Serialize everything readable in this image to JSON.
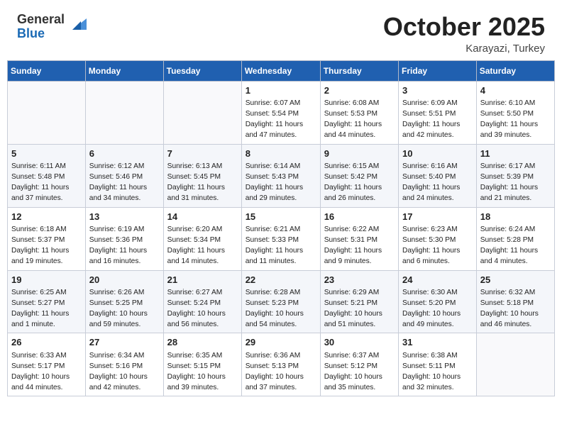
{
  "header": {
    "logo_general": "General",
    "logo_blue": "Blue",
    "month": "October 2025",
    "location": "Karayazi, Turkey"
  },
  "days_of_week": [
    "Sunday",
    "Monday",
    "Tuesday",
    "Wednesday",
    "Thursday",
    "Friday",
    "Saturday"
  ],
  "weeks": [
    [
      {
        "day": "",
        "sunrise": "",
        "sunset": "",
        "daylight": ""
      },
      {
        "day": "",
        "sunrise": "",
        "sunset": "",
        "daylight": ""
      },
      {
        "day": "",
        "sunrise": "",
        "sunset": "",
        "daylight": ""
      },
      {
        "day": "1",
        "sunrise": "Sunrise: 6:07 AM",
        "sunset": "Sunset: 5:54 PM",
        "daylight": "Daylight: 11 hours and 47 minutes."
      },
      {
        "day": "2",
        "sunrise": "Sunrise: 6:08 AM",
        "sunset": "Sunset: 5:53 PM",
        "daylight": "Daylight: 11 hours and 44 minutes."
      },
      {
        "day": "3",
        "sunrise": "Sunrise: 6:09 AM",
        "sunset": "Sunset: 5:51 PM",
        "daylight": "Daylight: 11 hours and 42 minutes."
      },
      {
        "day": "4",
        "sunrise": "Sunrise: 6:10 AM",
        "sunset": "Sunset: 5:50 PM",
        "daylight": "Daylight: 11 hours and 39 minutes."
      }
    ],
    [
      {
        "day": "5",
        "sunrise": "Sunrise: 6:11 AM",
        "sunset": "Sunset: 5:48 PM",
        "daylight": "Daylight: 11 hours and 37 minutes."
      },
      {
        "day": "6",
        "sunrise": "Sunrise: 6:12 AM",
        "sunset": "Sunset: 5:46 PM",
        "daylight": "Daylight: 11 hours and 34 minutes."
      },
      {
        "day": "7",
        "sunrise": "Sunrise: 6:13 AM",
        "sunset": "Sunset: 5:45 PM",
        "daylight": "Daylight: 11 hours and 31 minutes."
      },
      {
        "day": "8",
        "sunrise": "Sunrise: 6:14 AM",
        "sunset": "Sunset: 5:43 PM",
        "daylight": "Daylight: 11 hours and 29 minutes."
      },
      {
        "day": "9",
        "sunrise": "Sunrise: 6:15 AM",
        "sunset": "Sunset: 5:42 PM",
        "daylight": "Daylight: 11 hours and 26 minutes."
      },
      {
        "day": "10",
        "sunrise": "Sunrise: 6:16 AM",
        "sunset": "Sunset: 5:40 PM",
        "daylight": "Daylight: 11 hours and 24 minutes."
      },
      {
        "day": "11",
        "sunrise": "Sunrise: 6:17 AM",
        "sunset": "Sunset: 5:39 PM",
        "daylight": "Daylight: 11 hours and 21 minutes."
      }
    ],
    [
      {
        "day": "12",
        "sunrise": "Sunrise: 6:18 AM",
        "sunset": "Sunset: 5:37 PM",
        "daylight": "Daylight: 11 hours and 19 minutes."
      },
      {
        "day": "13",
        "sunrise": "Sunrise: 6:19 AM",
        "sunset": "Sunset: 5:36 PM",
        "daylight": "Daylight: 11 hours and 16 minutes."
      },
      {
        "day": "14",
        "sunrise": "Sunrise: 6:20 AM",
        "sunset": "Sunset: 5:34 PM",
        "daylight": "Daylight: 11 hours and 14 minutes."
      },
      {
        "day": "15",
        "sunrise": "Sunrise: 6:21 AM",
        "sunset": "Sunset: 5:33 PM",
        "daylight": "Daylight: 11 hours and 11 minutes."
      },
      {
        "day": "16",
        "sunrise": "Sunrise: 6:22 AM",
        "sunset": "Sunset: 5:31 PM",
        "daylight": "Daylight: 11 hours and 9 minutes."
      },
      {
        "day": "17",
        "sunrise": "Sunrise: 6:23 AM",
        "sunset": "Sunset: 5:30 PM",
        "daylight": "Daylight: 11 hours and 6 minutes."
      },
      {
        "day": "18",
        "sunrise": "Sunrise: 6:24 AM",
        "sunset": "Sunset: 5:28 PM",
        "daylight": "Daylight: 11 hours and 4 minutes."
      }
    ],
    [
      {
        "day": "19",
        "sunrise": "Sunrise: 6:25 AM",
        "sunset": "Sunset: 5:27 PM",
        "daylight": "Daylight: 11 hours and 1 minute."
      },
      {
        "day": "20",
        "sunrise": "Sunrise: 6:26 AM",
        "sunset": "Sunset: 5:25 PM",
        "daylight": "Daylight: 10 hours and 59 minutes."
      },
      {
        "day": "21",
        "sunrise": "Sunrise: 6:27 AM",
        "sunset": "Sunset: 5:24 PM",
        "daylight": "Daylight: 10 hours and 56 minutes."
      },
      {
        "day": "22",
        "sunrise": "Sunrise: 6:28 AM",
        "sunset": "Sunset: 5:23 PM",
        "daylight": "Daylight: 10 hours and 54 minutes."
      },
      {
        "day": "23",
        "sunrise": "Sunrise: 6:29 AM",
        "sunset": "Sunset: 5:21 PM",
        "daylight": "Daylight: 10 hours and 51 minutes."
      },
      {
        "day": "24",
        "sunrise": "Sunrise: 6:30 AM",
        "sunset": "Sunset: 5:20 PM",
        "daylight": "Daylight: 10 hours and 49 minutes."
      },
      {
        "day": "25",
        "sunrise": "Sunrise: 6:32 AM",
        "sunset": "Sunset: 5:18 PM",
        "daylight": "Daylight: 10 hours and 46 minutes."
      }
    ],
    [
      {
        "day": "26",
        "sunrise": "Sunrise: 6:33 AM",
        "sunset": "Sunset: 5:17 PM",
        "daylight": "Daylight: 10 hours and 44 minutes."
      },
      {
        "day": "27",
        "sunrise": "Sunrise: 6:34 AM",
        "sunset": "Sunset: 5:16 PM",
        "daylight": "Daylight: 10 hours and 42 minutes."
      },
      {
        "day": "28",
        "sunrise": "Sunrise: 6:35 AM",
        "sunset": "Sunset: 5:15 PM",
        "daylight": "Daylight: 10 hours and 39 minutes."
      },
      {
        "day": "29",
        "sunrise": "Sunrise: 6:36 AM",
        "sunset": "Sunset: 5:13 PM",
        "daylight": "Daylight: 10 hours and 37 minutes."
      },
      {
        "day": "30",
        "sunrise": "Sunrise: 6:37 AM",
        "sunset": "Sunset: 5:12 PM",
        "daylight": "Daylight: 10 hours and 35 minutes."
      },
      {
        "day": "31",
        "sunrise": "Sunrise: 6:38 AM",
        "sunset": "Sunset: 5:11 PM",
        "daylight": "Daylight: 10 hours and 32 minutes."
      },
      {
        "day": "",
        "sunrise": "",
        "sunset": "",
        "daylight": ""
      }
    ]
  ]
}
